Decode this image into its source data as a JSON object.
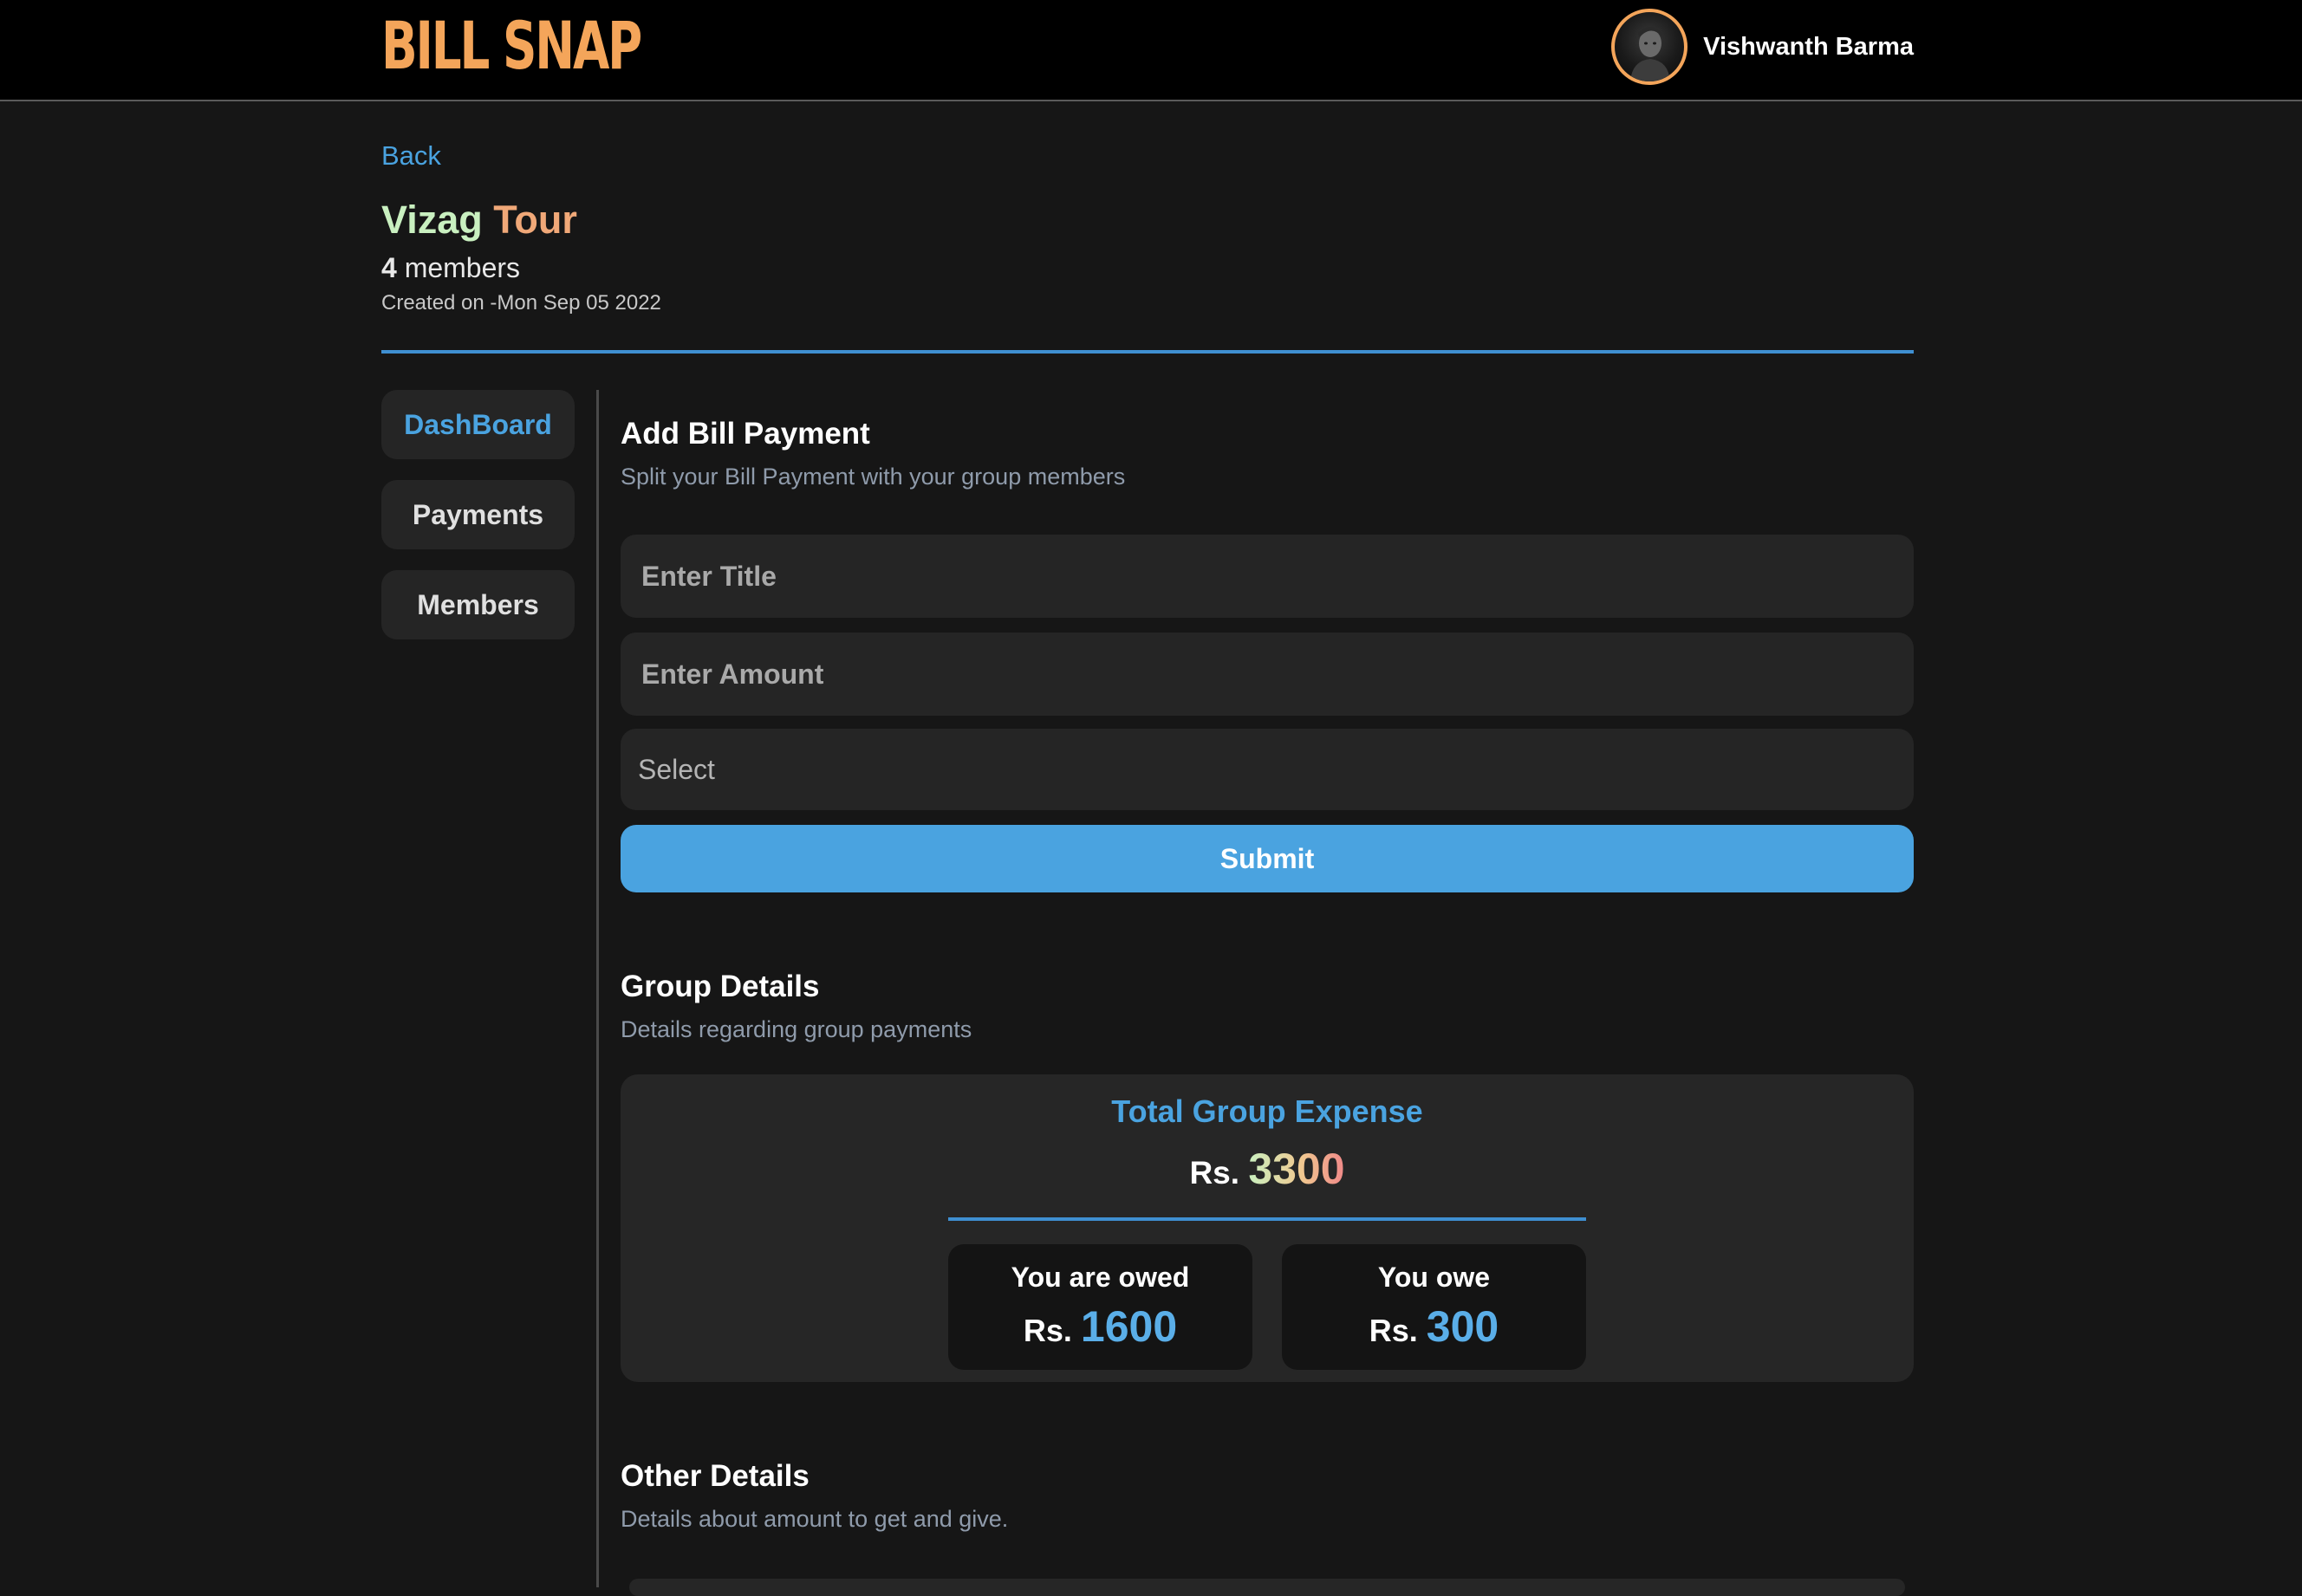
{
  "header": {
    "brand": "BILL SNAP",
    "user_name": "Vishwanth Barma"
  },
  "page": {
    "back_label": "Back",
    "group_title_part1": "Vizag",
    "group_title_part2": "Tour",
    "member_count": "4",
    "member_label": "members",
    "created_on": "Created on -Mon Sep 05 2022"
  },
  "sidebar": {
    "items": [
      {
        "label": "DashBoard",
        "active": true
      },
      {
        "label": "Payments",
        "active": false
      },
      {
        "label": "Members",
        "active": false
      }
    ]
  },
  "add_bill": {
    "title": "Add Bill Payment",
    "subtitle": "Split your Bill Payment with your group members",
    "title_placeholder": "Enter Title",
    "amount_placeholder": "Enter Amount",
    "select_value": "Select",
    "submit_label": "Submit"
  },
  "group_details": {
    "title": "Group Details",
    "subtitle": "Details regarding group payments",
    "total_label": "Total Group Expense",
    "currency": "Rs.",
    "total_amount": "3300",
    "owed_label": "You are owed",
    "owed_amount": "1600",
    "owe_label": "You owe",
    "owe_amount": "300"
  },
  "other_details": {
    "title": "Other Details",
    "subtitle": "Details about amount to get and give."
  },
  "colors": {
    "accent_blue": "#4aa3e0",
    "brand_orange": "#f4a55a",
    "background": "#161616",
    "panel": "#252525"
  }
}
